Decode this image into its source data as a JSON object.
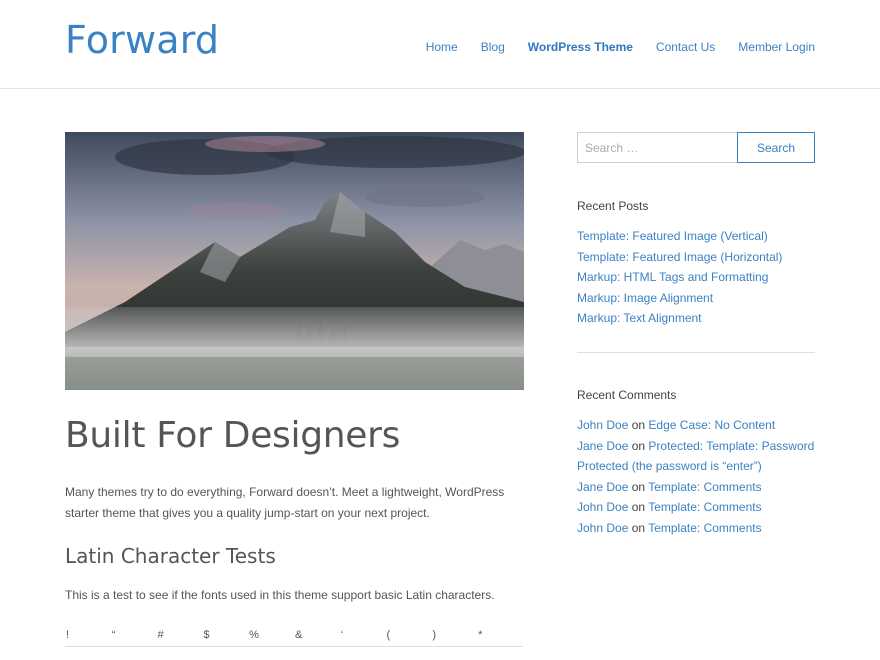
{
  "site": {
    "title": "Forward"
  },
  "nav": [
    {
      "label": "Home"
    },
    {
      "label": "Blog"
    },
    {
      "label": "WordPress Theme"
    },
    {
      "label": "Contact Us"
    },
    {
      "label": "Member Login"
    }
  ],
  "post": {
    "title": "Built For Designers",
    "intro": "Many themes try to do everything, Forward doesn’t. Meet a lightweight, WordPress starter theme that gives you a quality jump-start on your next project.",
    "section_heading": "Latin Character Tests",
    "section_text": "This is a test to see if the fonts used in this theme support basic Latin characters.",
    "char_row": [
      "!",
      "“",
      "#",
      "$",
      "%",
      "&",
      "‘",
      "(",
      ")",
      "*"
    ]
  },
  "sidebar": {
    "search_placeholder": "Search …",
    "search_button": "Search",
    "recent_posts_title": "Recent Posts",
    "recent_posts": [
      "Template: Featured Image (Vertical)",
      "Template: Featured Image (Horizontal)",
      "Markup: HTML Tags and Formatting",
      "Markup: Image Alignment",
      "Markup: Text Alignment"
    ],
    "recent_comments_title": "Recent Comments",
    "comment_joiner": "on",
    "recent_comments": [
      {
        "author": "John Doe",
        "post": "Edge Case: No Content"
      },
      {
        "author": "Jane Doe",
        "post": "Protected: Template: Password Protected (the password is “enter”)"
      },
      {
        "author": "Jane Doe",
        "post": "Template: Comments"
      },
      {
        "author": "John Doe",
        "post": "Template: Comments"
      },
      {
        "author": "John Doe",
        "post": "Template: Comments"
      }
    ]
  },
  "colors": {
    "accent": "#3b82c4",
    "text": "#555555",
    "border": "#e3e3e3"
  },
  "icons": {
    "hero": "mountain-landscape-image"
  }
}
